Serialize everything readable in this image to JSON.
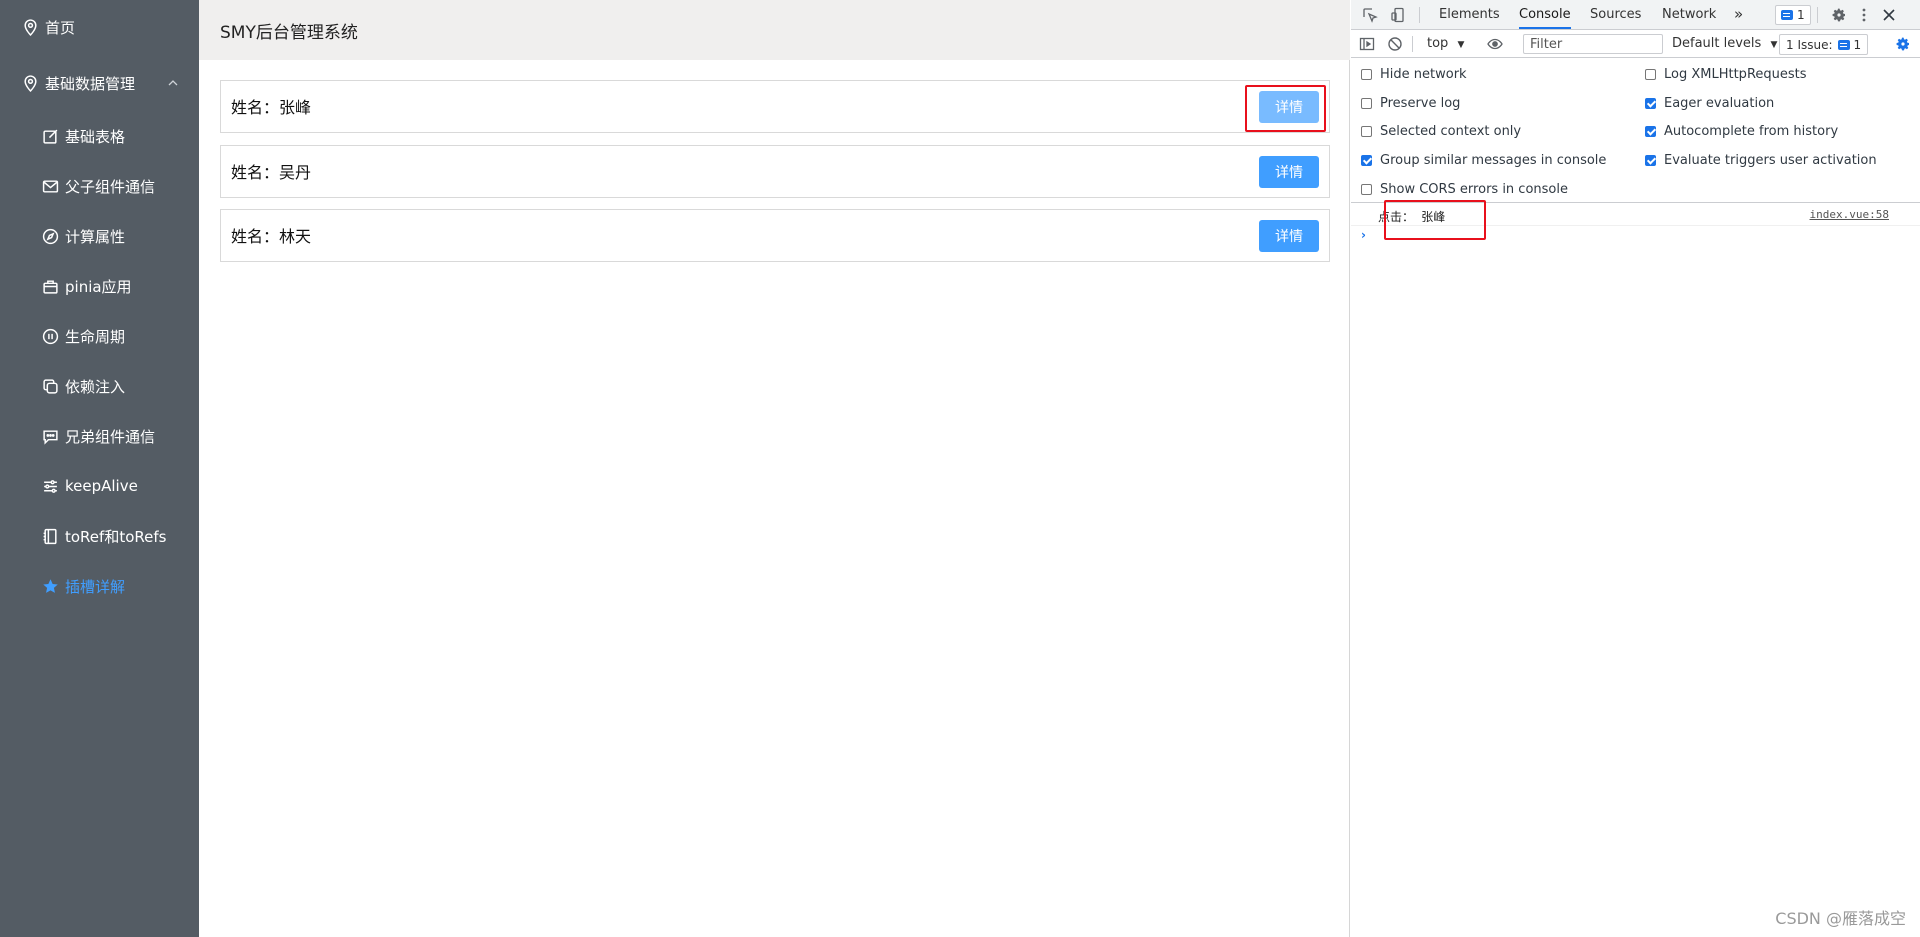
{
  "sidebar": {
    "items": [
      {
        "label": "首页",
        "icon": "location-icon",
        "level": "top"
      },
      {
        "label": "基础数据管理",
        "icon": "location-icon",
        "level": "top",
        "expanded": true
      },
      {
        "label": "基础表格",
        "icon": "edit-icon",
        "level": "sub"
      },
      {
        "label": "父子组件通信",
        "icon": "message-icon",
        "level": "sub"
      },
      {
        "label": "计算属性",
        "icon": "compass-icon",
        "level": "sub"
      },
      {
        "label": "pinia应用",
        "icon": "briefcase-icon",
        "level": "sub"
      },
      {
        "label": "生命周期",
        "icon": "pause-icon",
        "level": "sub"
      },
      {
        "label": "依赖注入",
        "icon": "copy-icon",
        "level": "sub"
      },
      {
        "label": "兄弟组件通信",
        "icon": "chat-dots-icon",
        "level": "sub"
      },
      {
        "label": "keepAlive",
        "icon": "sliders-icon",
        "level": "sub"
      },
      {
        "label": "toRef和toRefs",
        "icon": "notebook-icon",
        "level": "sub"
      },
      {
        "label": "插槽详解",
        "icon": "star-icon",
        "level": "sub",
        "active": true
      }
    ],
    "colors": {
      "background": "#545c64",
      "text": "#ffffff",
      "active": "#409eff"
    }
  },
  "header": {
    "title": "SMY后台管理系统"
  },
  "list": {
    "items": [
      {
        "label": "姓名：张峰",
        "button": "详情",
        "hovered": true
      },
      {
        "label": "姓名：吴丹",
        "button": "详情"
      },
      {
        "label": "姓名：林天",
        "button": "详情"
      }
    ],
    "colors": {
      "button": "#409eff",
      "button_hover": "#79bbff",
      "highlight": "#e8101c"
    }
  },
  "devtools": {
    "tabs": [
      "Elements",
      "Console",
      "Sources",
      "Network"
    ],
    "selected_tab": "Console",
    "more_tabs": "»",
    "message_count": "1",
    "toolbar": {
      "context": "top",
      "filter_placeholder": "Filter",
      "levels": "Default levels",
      "issues": "1 Issue:",
      "issues_count": "1"
    },
    "options_left": [
      {
        "label": "Hide network",
        "checked": false
      },
      {
        "label": "Preserve log",
        "checked": false
      },
      {
        "label": "Selected context only",
        "checked": false
      },
      {
        "label": "Group similar messages in console",
        "checked": true
      },
      {
        "label": "Show CORS errors in console",
        "checked": false
      }
    ],
    "options_right": [
      {
        "label": "Log XMLHttpRequests",
        "checked": false
      },
      {
        "label": "Eager evaluation",
        "checked": true
      },
      {
        "label": "Autocomplete from history",
        "checked": true
      },
      {
        "label": "Evaluate triggers user activation",
        "checked": true
      }
    ],
    "log": {
      "message": "点击： 张峰",
      "source": "index.vue:58"
    },
    "prompt": "›",
    "colors": {
      "accent": "#1a73e8"
    }
  },
  "watermark": "CSDN @雁落成空"
}
